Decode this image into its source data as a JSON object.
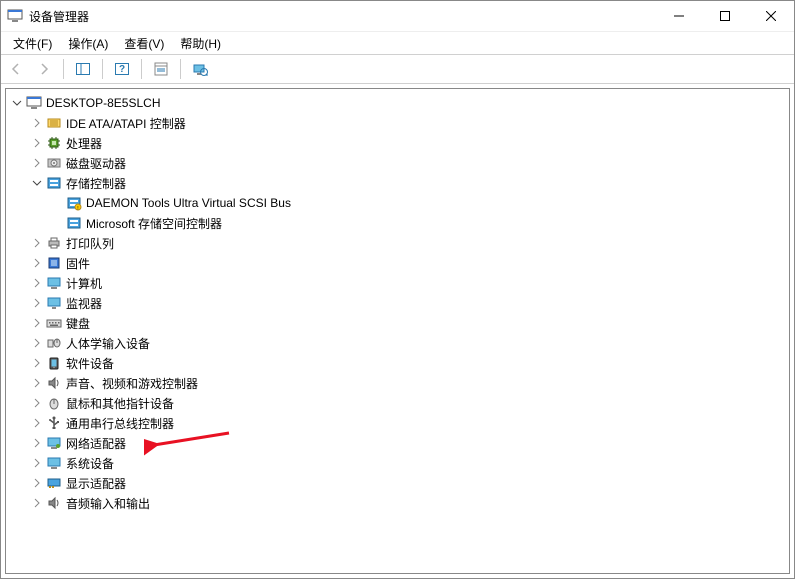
{
  "window": {
    "title": "设备管理器"
  },
  "menu": {
    "file": "文件(F)",
    "action": "操作(A)",
    "view": "查看(V)",
    "help": "帮助(H)"
  },
  "tree": {
    "root": "DESKTOP-8E5SLCH",
    "ide": "IDE ATA/ATAPI 控制器",
    "cpu": "处理器",
    "disk": "磁盘驱动器",
    "storage": "存储控制器",
    "storage_items": {
      "daemon": "DAEMON Tools Ultra Virtual SCSI Bus",
      "msspaces": "Microsoft 存储空间控制器"
    },
    "printq": "打印队列",
    "firmware": "固件",
    "computer": "计算机",
    "monitor": "监视器",
    "keyboard": "键盘",
    "hid": "人体学输入设备",
    "softdev": "软件设备",
    "sound": "声音、视频和游戏控制器",
    "mouse": "鼠标和其他指针设备",
    "usb": "通用串行总线控制器",
    "network": "网络适配器",
    "system": "系统设备",
    "display": "显示适配器",
    "audioio": "音频输入和输出"
  }
}
